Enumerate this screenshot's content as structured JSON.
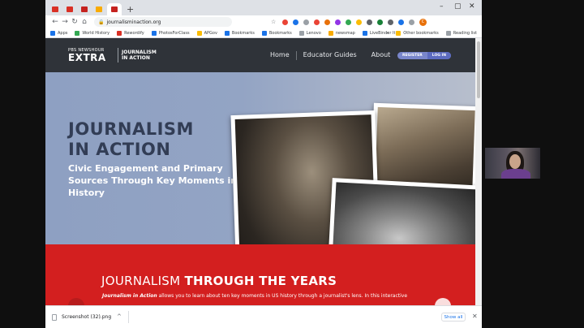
{
  "browser": {
    "tabs": [
      {
        "color": "#d93025"
      },
      {
        "color": "#d93025"
      },
      {
        "color": "#c5221f"
      },
      {
        "color": "#f9ab00"
      },
      {
        "color": "#c5221f",
        "active": true
      }
    ],
    "new_tab": "+",
    "window_controls": [
      "–",
      "▢",
      "✕"
    ],
    "url": "journalisminaction.org",
    "nav": {
      "back": "←",
      "forward": "→",
      "reload": "↻",
      "home": "⌂"
    },
    "profile_initial": "C",
    "extensions": [
      "#ea4335",
      "#1a73e8",
      "#9aa0a6",
      "#ea4335",
      "#e8710a",
      "#9334e6",
      "#34a853",
      "#fbbc04",
      "#5f6368",
      "#188038",
      "#5f6368",
      "#1a73e8",
      "#9aa0a6",
      "#e8710a"
    ]
  },
  "bookmarks": {
    "items": [
      {
        "label": "Apps",
        "color": "#1a73e8"
      },
      {
        "label": "World History",
        "color": "#34a853"
      },
      {
        "label": "Rewordify",
        "color": "#d93025"
      },
      {
        "label": "PhotosForClass",
        "color": "#1a73e8"
      },
      {
        "label": "APGov",
        "color": "#fbbc04"
      },
      {
        "label": "Bookmarks",
        "color": "#1a73e8"
      },
      {
        "label": "Bookmarks",
        "color": "#1a73e8"
      },
      {
        "label": "Lenovo",
        "color": "#9aa0a6"
      },
      {
        "label": "newsmap",
        "color": "#f9ab00"
      },
      {
        "label": "LiveBinder It",
        "color": "#1a73e8"
      }
    ],
    "more": "»",
    "other": "Other bookmarks",
    "reading": "Reading list"
  },
  "site": {
    "logo_top": "PBS NEWSHOUR",
    "logo_main": "EXTRA",
    "logo_sub_1": "JOURNALISM",
    "logo_sub_2": "IN ACTION",
    "nav": [
      "Home",
      "Educator Guides",
      "About"
    ],
    "register": "REGISTER",
    "login": "LOG IN"
  },
  "hero": {
    "title_1": "JOURNALISM",
    "title_2": "IN ACTION",
    "subtitle": "Civic Engagement and Primary Sources Through Key Moments in History"
  },
  "section": {
    "heading_light": "JOURNALISM",
    "heading_bold": "THROUGH THE YEARS",
    "intro_em": "Journalism in Action",
    "intro_rest": " allows you to learn about ten key moments in US history through a journalist's lens. In this interactive"
  },
  "downloads": {
    "file": "Screenshot (32).png",
    "chevron": "^",
    "show_all": "Show all",
    "close": "✕"
  }
}
